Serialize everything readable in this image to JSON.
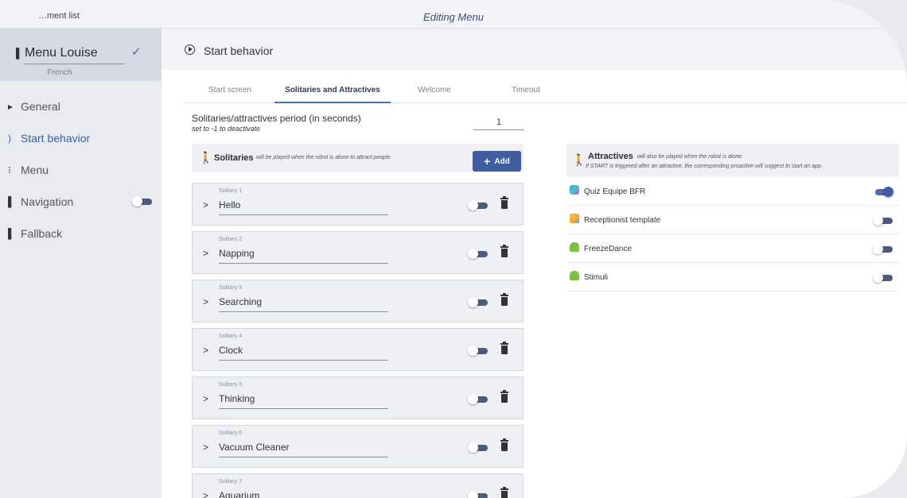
{
  "window": {
    "back_label": "…ment list",
    "title": "Editing Menu"
  },
  "sidebar": {
    "menu_name": "Menu Louise",
    "language": "French",
    "items": [
      {
        "label": "General",
        "icon": "bullet-icon"
      },
      {
        "label": "Start behavior",
        "icon": "play-circle-icon"
      },
      {
        "label": "Menu",
        "icon": "dots-icon"
      },
      {
        "label": "Navigation",
        "icon": "bullet-icon",
        "toggle": "off"
      },
      {
        "label": "Fallback",
        "icon": "bullet-icon"
      }
    ]
  },
  "main": {
    "section_title": "Start behavior",
    "tabs": [
      {
        "label": "Start screen"
      },
      {
        "label": "Solitaries and Attractives",
        "active": true
      },
      {
        "label": "Welcome"
      },
      {
        "label": "Timeout"
      }
    ],
    "period": {
      "label": "Solitaries/attractives period (in seconds)",
      "hint": "set to -1 to deactivate",
      "value": "1"
    },
    "solitaries": {
      "title": "Solitaries",
      "subtitle": "will be played when the robot is alone to attract people.",
      "add_label": "Add",
      "items": [
        {
          "label": "Solitary 1",
          "value": "Hello",
          "enabled": false
        },
        {
          "label": "Solitary 2",
          "value": "Napping",
          "enabled": false
        },
        {
          "label": "Solitary 3",
          "value": "Searching",
          "enabled": false
        },
        {
          "label": "Solitary 4",
          "value": "Clock",
          "enabled": false
        },
        {
          "label": "Solitary 5",
          "value": "Thinking",
          "enabled": false
        },
        {
          "label": "Solitary 6",
          "value": "Vacuum Cleaner",
          "enabled": false
        },
        {
          "label": "Solitary 7",
          "value": "Aquarium",
          "enabled": false
        }
      ]
    },
    "attractives": {
      "title": "Attractives",
      "subtitle_1": "will also be played when the robot is alone.",
      "subtitle_2": "If START is triggered after an attractive, the corresponding proactive will suggest to start an app.",
      "items": [
        {
          "label": "Quiz Equipe BFR",
          "icon": "quiz-app-icon",
          "enabled": true
        },
        {
          "label": "Receptionist template",
          "icon": "receptionist-app-icon",
          "enabled": false
        },
        {
          "label": "FreezeDance",
          "icon": "android-icon",
          "enabled": false
        },
        {
          "label": "Stimuli",
          "icon": "android-icon",
          "enabled": false
        }
      ]
    }
  },
  "colors": {
    "accent": "#4d6bb0",
    "button": "#3f5d9f",
    "sidebar_bg": "#e9ebf0",
    "sidebar_head_bg": "#d5dae4"
  }
}
